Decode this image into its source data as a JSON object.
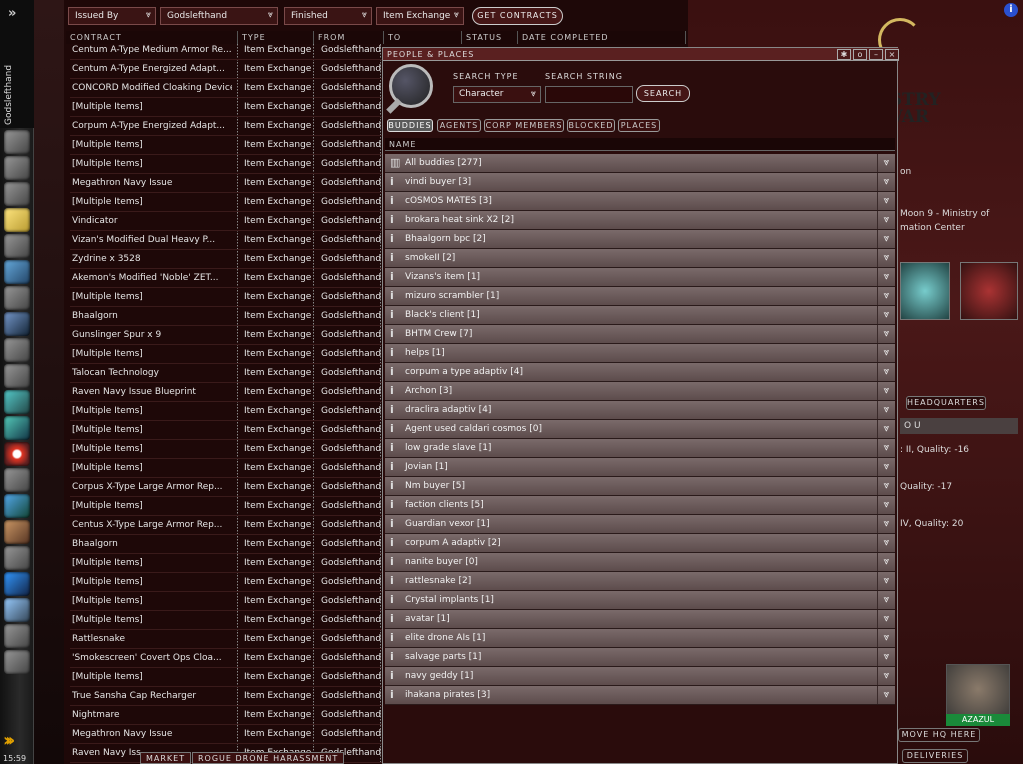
{
  "sidebar": {
    "character_name": "Godslefthand",
    "clock": "15:59",
    "icons": [
      "character-icon",
      "mail-icon",
      "notepad-icon",
      "map-icon",
      "market-icon",
      "contracts-icon",
      "fitting-icon",
      "people-icon",
      "corporation-icon",
      "assets-icon",
      "science-icon",
      "wallet-icon",
      "journal-icon",
      "news-icon",
      "help-icon",
      "chat-icon",
      "settings-icon",
      "ship-icon",
      "drone-icon"
    ]
  },
  "contracts": {
    "filters": {
      "issued_by": "Issued By",
      "owner": "Godslefthand",
      "status": "Finished",
      "type": "Item Exchange",
      "button": "GET CONTRACTS"
    },
    "headers": {
      "contract": "CONTRACT",
      "type": "TYPE",
      "from": "FROM",
      "to": "TO",
      "status": "STATUS",
      "date": "DATE COMPLETED"
    },
    "rows": [
      {
        "name": "Centum A-Type Medium Armor Re...",
        "type": "Item Exchange",
        "from": "Godslefthand"
      },
      {
        "name": "Centum A-Type Energized Adapt...",
        "type": "Item Exchange",
        "from": "Godslefthand"
      },
      {
        "name": "CONCORD Modified Cloaking Device",
        "type": "Item Exchange",
        "from": "Godslefthand"
      },
      {
        "name": "[Multiple Items]",
        "type": "Item Exchange",
        "from": "Godslefthand"
      },
      {
        "name": "Corpum A-Type Energized Adapt...",
        "type": "Item Exchange",
        "from": "Godslefthand"
      },
      {
        "name": "[Multiple Items]",
        "type": "Item Exchange",
        "from": "Godslefthand"
      },
      {
        "name": "[Multiple Items]",
        "type": "Item Exchange",
        "from": "Godslefthand"
      },
      {
        "name": "Megathron Navy Issue",
        "type": "Item Exchange",
        "from": "Godslefthand"
      },
      {
        "name": "[Multiple Items]",
        "type": "Item Exchange",
        "from": "Godslefthand"
      },
      {
        "name": "Vindicator",
        "type": "Item Exchange",
        "from": "Godslefthand"
      },
      {
        "name": "Vizan's Modified Dual Heavy P...",
        "type": "Item Exchange",
        "from": "Godslefthand"
      },
      {
        "name": "Zydrine x 3528",
        "type": "Item Exchange",
        "from": "Godslefthand"
      },
      {
        "name": "Akemon's Modified 'Noble' ZET...",
        "type": "Item Exchange",
        "from": "Godslefthand"
      },
      {
        "name": "[Multiple Items]",
        "type": "Item Exchange",
        "from": "Godslefthand"
      },
      {
        "name": "Bhaalgorn",
        "type": "Item Exchange",
        "from": "Godslefthand"
      },
      {
        "name": "Gunslinger Spur x 9",
        "type": "Item Exchange",
        "from": "Godslefthand"
      },
      {
        "name": "[Multiple Items]",
        "type": "Item Exchange",
        "from": "Godslefthand"
      },
      {
        "name": "Talocan Technology",
        "type": "Item Exchange",
        "from": "Godslefthand"
      },
      {
        "name": "Raven Navy Issue Blueprint",
        "type": "Item Exchange",
        "from": "Godslefthand"
      },
      {
        "name": "[Multiple Items]",
        "type": "Item Exchange",
        "from": "Godslefthand"
      },
      {
        "name": "[Multiple Items]",
        "type": "Item Exchange",
        "from": "Godslefthand"
      },
      {
        "name": "[Multiple Items]",
        "type": "Item Exchange",
        "from": "Godslefthand"
      },
      {
        "name": "[Multiple Items]",
        "type": "Item Exchange",
        "from": "Godslefthand"
      },
      {
        "name": "Corpus X-Type Large Armor Rep...",
        "type": "Item Exchange",
        "from": "Godslefthand"
      },
      {
        "name": "[Multiple Items]",
        "type": "Item Exchange",
        "from": "Godslefthand"
      },
      {
        "name": "Centus X-Type Large Armor Rep...",
        "type": "Item Exchange",
        "from": "Godslefthand"
      },
      {
        "name": "Bhaalgorn",
        "type": "Item Exchange",
        "from": "Godslefthand"
      },
      {
        "name": "[Multiple Items]",
        "type": "Item Exchange",
        "from": "Godslefthand"
      },
      {
        "name": "[Multiple Items]",
        "type": "Item Exchange",
        "from": "Godslefthand"
      },
      {
        "name": "[Multiple Items]",
        "type": "Item Exchange",
        "from": "Godslefthand"
      },
      {
        "name": "[Multiple Items]",
        "type": "Item Exchange",
        "from": "Godslefthand"
      },
      {
        "name": "Rattlesnake",
        "type": "Item Exchange",
        "from": "Godslefthand"
      },
      {
        "name": "'Smokescreen' Covert Ops Cloa...",
        "type": "Item Exchange",
        "from": "Godslefthand"
      },
      {
        "name": "[Multiple Items]",
        "type": "Item Exchange",
        "from": "Godslefthand"
      },
      {
        "name": "True Sansha Cap Recharger",
        "type": "Item Exchange",
        "from": "Godslefthand"
      },
      {
        "name": "Nightmare",
        "type": "Item Exchange",
        "from": "Godslefthand"
      },
      {
        "name": "Megathron Navy Issue",
        "type": "Item Exchange",
        "from": "Godslefthand"
      },
      {
        "name": "Raven Navy Iss",
        "type": "Item Exchange",
        "from": "Godslefthand"
      }
    ]
  },
  "people": {
    "title": "PEOPLE & PLACES",
    "search_type_label": "SEARCH TYPE",
    "search_string_label": "SEARCH STRING",
    "search_type_value": "Character",
    "search_button": "SEARCH",
    "tabs": [
      "BUDDIES",
      "AGENTS",
      "CORP MEMBERS",
      "BLOCKED",
      "PLACES"
    ],
    "name_header": "NAME",
    "groups": [
      "All buddies [277]",
      "vindi buyer [3]",
      "cOSMOS MATES [3]",
      "brokara heat sink X2 [2]",
      "Bhaalgorn bpc [2]",
      "smokeII [2]",
      "Vizans's item [1]",
      "mizuro scrambler [1]",
      "Black's client [1]",
      "BHTM Crew [7]",
      "helps [1]",
      "corpum a type adaptiv [4]",
      "Archon [3]",
      "draclira adaptiv [4]",
      "Agent used caldari cosmos [0]",
      "low grade slave [1]",
      "Jovian [1]",
      "Nm buyer [5]",
      "faction clients [5]",
      "Guardian vexor [1]",
      "corpum A adaptiv [2]",
      "nanite buyer [0]",
      "rattlesnake [2]",
      "Crystal implants [1]",
      "avatar [1]",
      "elite drone AIs [1]",
      "salvage parts [1]",
      "navy geddy [1]",
      "ihakana pirates [3]"
    ]
  },
  "right_panel": {
    "title": "MINISTRY OF WAR",
    "text1": "on",
    "text2": "Moon 9 - Ministry of",
    "text3": "mation Center",
    "hq_tab": "HEADQUARTERS",
    "ou": "O U",
    "q1": ": II, Quality: -16",
    "q2": "Quality: -17",
    "q3": "IV, Quality: 20",
    "move_hq": "MOVE HQ HERE",
    "deliveries": "DELIVERIES"
  },
  "bottom_tabs": [
    "MARKET",
    "ROGUE DRONE HARASSMENT"
  ],
  "pilot": {
    "name": "AZAZUL"
  }
}
